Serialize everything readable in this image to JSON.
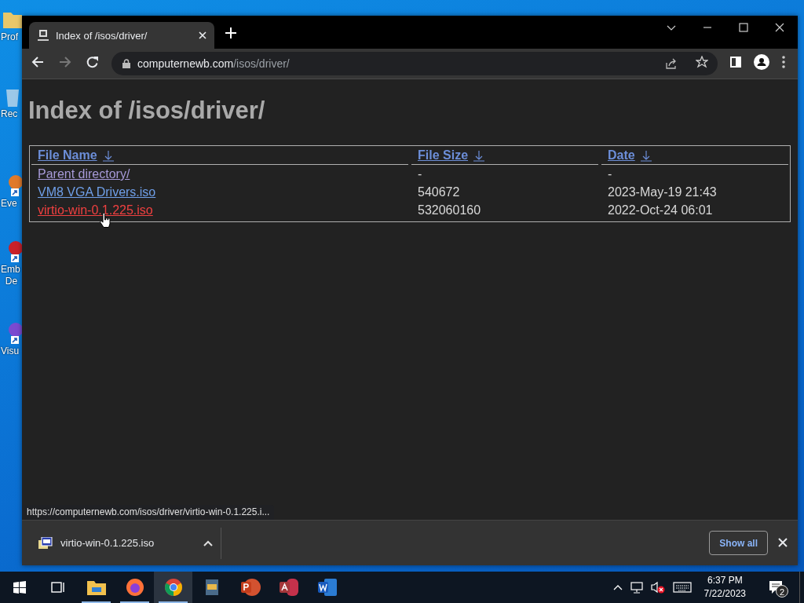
{
  "desktop": {
    "icons": [
      {
        "kind": "folder",
        "color": "#e8c76a",
        "label_lines": [
          "Prof"
        ]
      },
      {
        "kind": "recycle-bin",
        "color": "#9cc8e8",
        "label_lines": [
          "Rec"
        ]
      },
      {
        "kind": "shortcut",
        "color": "#e07a2a",
        "label_lines": [
          "Eve"
        ]
      },
      {
        "kind": "shortcut",
        "color": "#c8202a",
        "label_lines": [
          "Emb",
          "De"
        ]
      },
      {
        "kind": "shortcut",
        "color": "#7a4ad0",
        "label_lines": [
          "Visu"
        ]
      }
    ]
  },
  "browser": {
    "tab": {
      "title": "Index of /isos/driver/",
      "selected": true
    },
    "address": {
      "host": "computernewb.com",
      "path": "/isos/driver/"
    },
    "page": {
      "heading": "Index of /isos/driver/",
      "table": {
        "columns": [
          "File Name",
          "File Size",
          "Date"
        ],
        "rows": [
          {
            "name": "Parent directory/",
            "size": "-",
            "date": "-",
            "visited": true,
            "hovered": false
          },
          {
            "name": "VM8 VGA Drivers.iso",
            "size": "540672",
            "date": "2023-May-19 21:43",
            "visited": false,
            "hovered": false
          },
          {
            "name": "virtio-win-0.1.225.iso",
            "size": "532060160",
            "date": "2022-Oct-24 06:01",
            "visited": false,
            "hovered": true
          }
        ]
      }
    },
    "status_url": "https://computernewb.com/isos/driver/virtio-win-0.1.225.i...",
    "downloads": [
      {
        "filename": "virtio-win-0.1.225.iso"
      }
    ],
    "show_all": "Show all"
  },
  "taskbar": {
    "apps": [
      {
        "kind": "explorer",
        "running": true,
        "selected": false
      },
      {
        "kind": "firefox",
        "running": true,
        "selected": false
      },
      {
        "kind": "chrome",
        "running": true,
        "selected": true
      },
      {
        "kind": "viewer",
        "running": false,
        "selected": false
      },
      {
        "kind": "powerpoint",
        "running": false,
        "selected": false
      },
      {
        "kind": "access",
        "running": false,
        "selected": false
      },
      {
        "kind": "word",
        "running": false,
        "selected": false
      }
    ],
    "clock": {
      "time": "6:37 PM",
      "date": "7/22/2023"
    },
    "notification_count": "2"
  }
}
